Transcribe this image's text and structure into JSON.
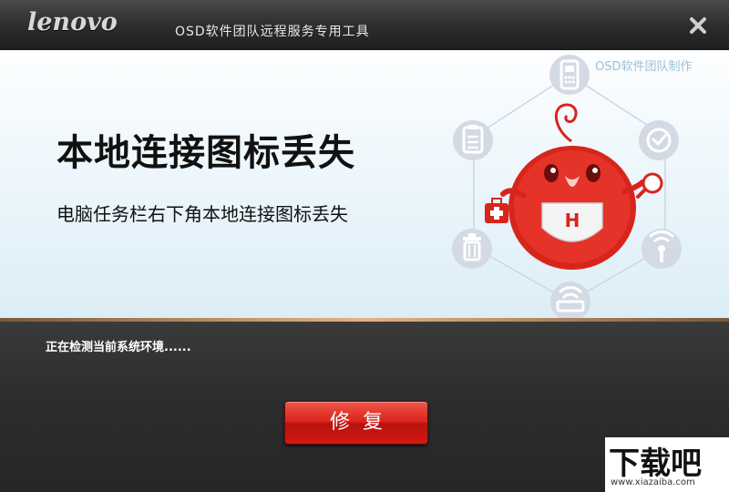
{
  "titlebar": {
    "logo": "lenovo",
    "app_title": "OSD软件团队远程服务专用工具",
    "close_icon": "close-icon"
  },
  "banner": {
    "watermark": "OSD软件团队制作",
    "headline": "本地连接图标丢失",
    "subline": "电脑任务栏右下角本地连接图标丢失",
    "icons": [
      "phone-icon",
      "clock-icon",
      "clipboard-icon",
      "trash-icon",
      "signal-icon",
      "router-icon",
      "mascot-icon",
      "medkit-icon"
    ]
  },
  "panel": {
    "status_text": "正在检测当前系统环境......",
    "repair_label": "修复"
  },
  "site_logo": {
    "name": "下载吧",
    "url": "www.xiazaiba.com"
  },
  "colors": {
    "accent_red": "#d9231b",
    "dark_bg": "#2f2f2f",
    "banner_bg": "#eaf5fb",
    "icon_circle": "#d7dde6",
    "icon_glyph": "#ffffff"
  }
}
